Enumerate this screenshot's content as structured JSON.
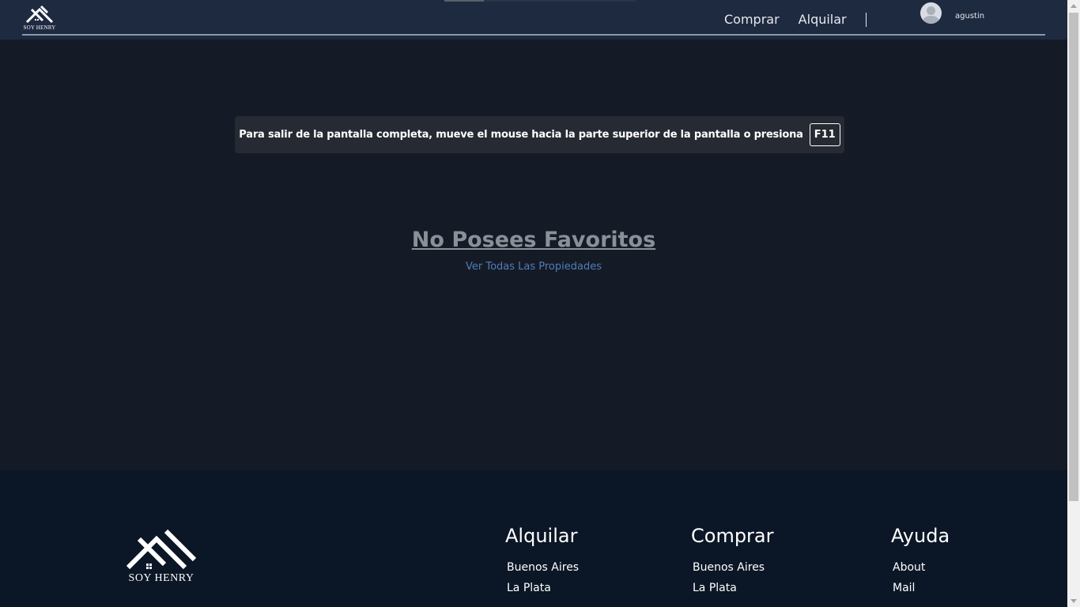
{
  "header": {
    "logo_text": "SOY HENRY",
    "nav": [
      "Comprar",
      "Alquilar"
    ],
    "username": "agustin"
  },
  "fullscreen_notice": {
    "message": "Para salir de la pantalla completa, mueve el mouse hacia la parte superior de la pantalla o presiona",
    "key": "F11"
  },
  "favorites": {
    "empty_title": "No Posees Favoritos",
    "link": "Ver Todas Las Propiedades"
  },
  "footer": {
    "logo_text": "SOY HENRY",
    "columns": [
      {
        "title": "Alquilar",
        "links": [
          "Buenos Aires",
          "La Plata"
        ]
      },
      {
        "title": "Comprar",
        "links": [
          "Buenos Aires",
          "La Plata"
        ]
      },
      {
        "title": "Ayuda",
        "links": [
          "About",
          "Mail"
        ]
      }
    ]
  },
  "colors": {
    "header_bg": "#1e2a40",
    "page_bg": "#151b26",
    "footer_bg": "#0b1726",
    "link": "#4f7db8"
  }
}
